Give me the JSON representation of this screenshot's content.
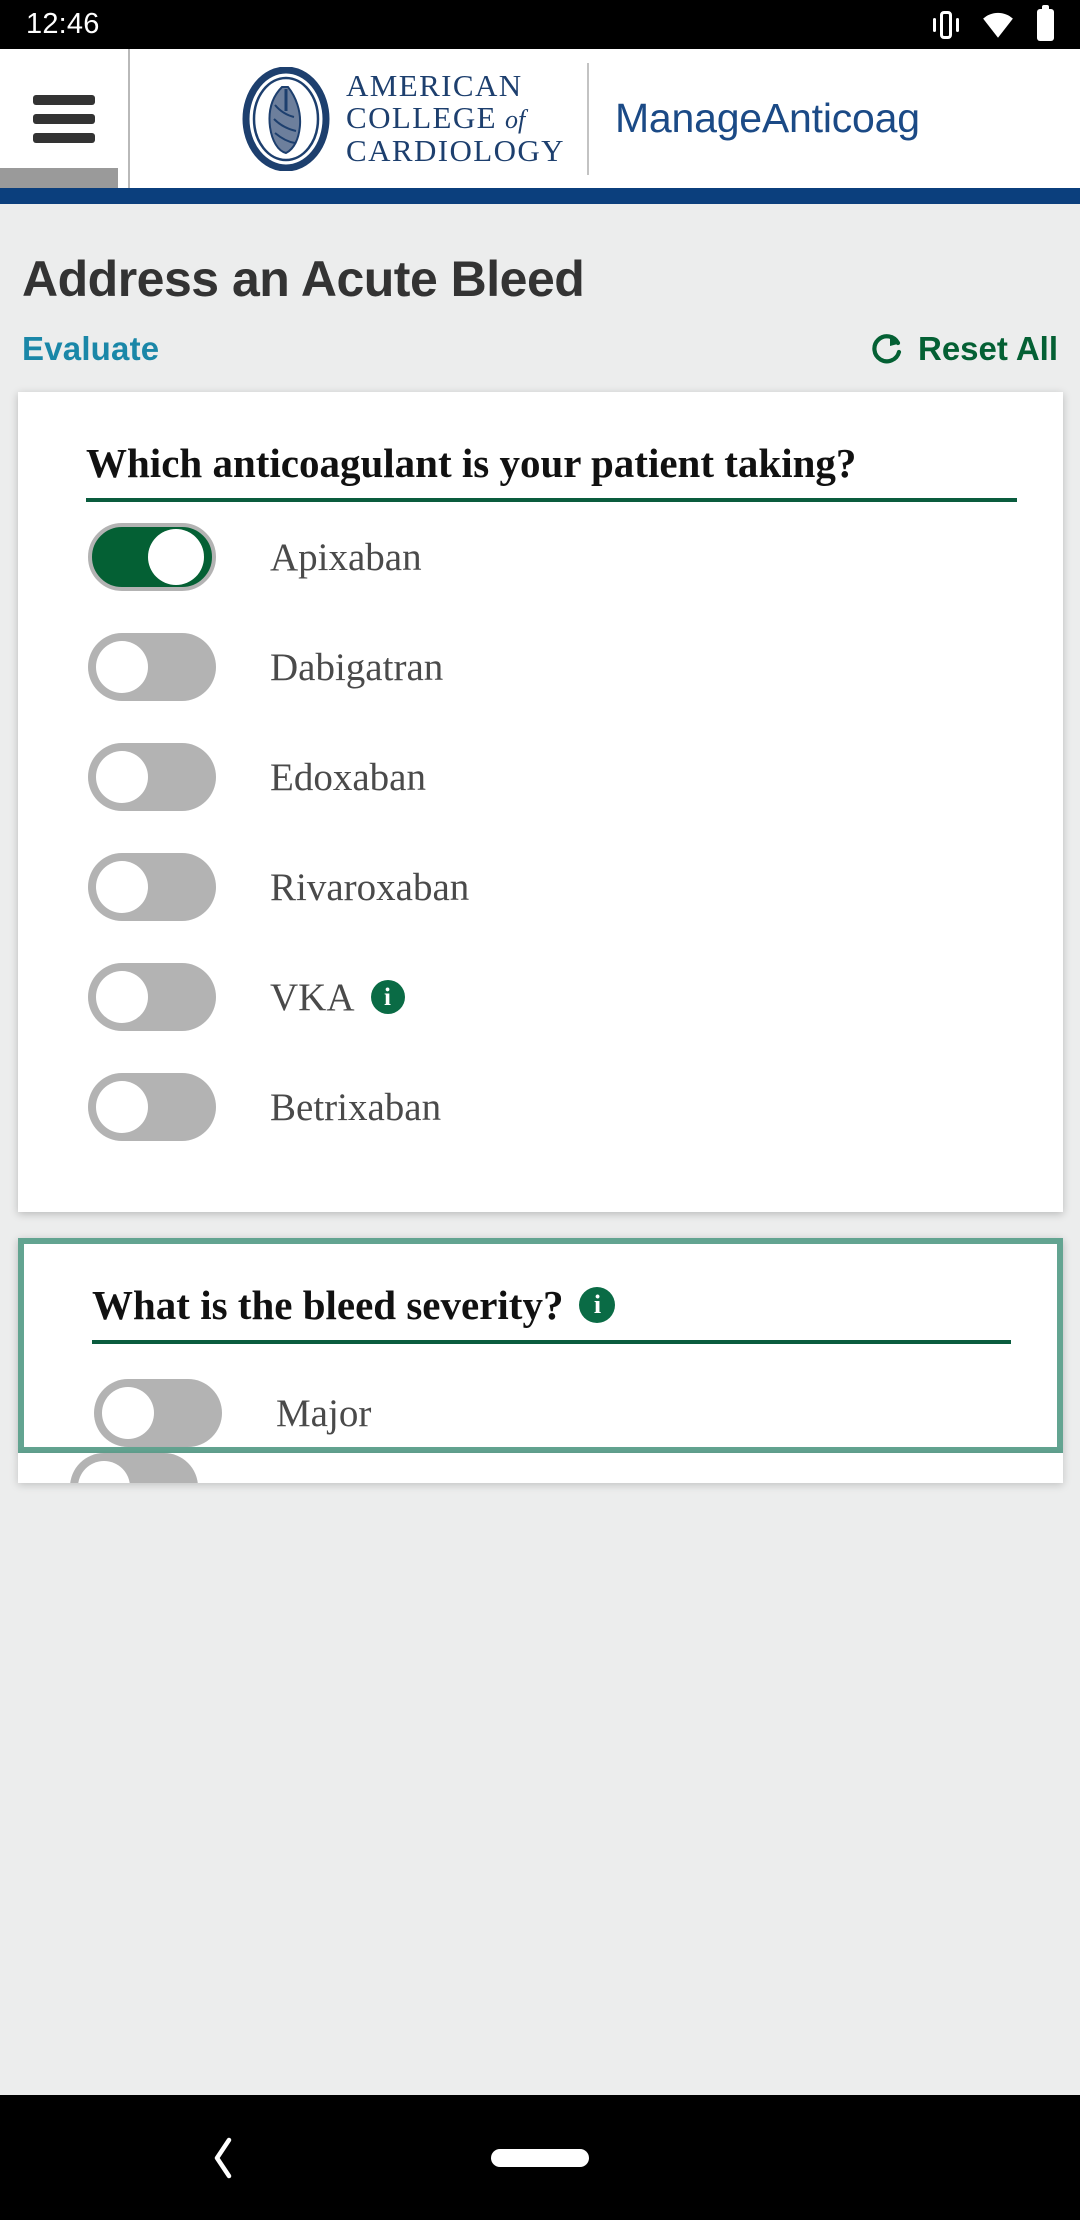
{
  "status_bar": {
    "time": "12:46",
    "icons": [
      "vibrate-icon",
      "wifi-icon",
      "battery-icon"
    ]
  },
  "header": {
    "menu_icon": "hamburger-menu-icon",
    "logo": {
      "line1": "AMERICAN",
      "line2": "COLLEGE",
      "line2_italic": "of",
      "line3": "CARDIOLOGY",
      "seal": "acc-heart-seal-icon"
    },
    "app_title": "ManageAnticoag",
    "brand_color": "#1b4a86",
    "accent_bar_color": "#0b3f7d"
  },
  "page": {
    "title": "Address an Acute Bleed",
    "evaluate_label": "Evaluate",
    "evaluate_color": "#1a87a8",
    "reset_label": "Reset All",
    "reset_color": "#046034",
    "reset_icon": "refresh-icon"
  },
  "cards": [
    {
      "question": "Which anticoagulant is your patient taking?",
      "has_info": false,
      "highlighted": false,
      "options": [
        {
          "label": "Apixaban",
          "on": true,
          "info": false
        },
        {
          "label": "Dabigatran",
          "on": false,
          "info": false
        },
        {
          "label": "Edoxaban",
          "on": false,
          "info": false
        },
        {
          "label": "Rivaroxaban",
          "on": false,
          "info": false
        },
        {
          "label": "VKA",
          "on": false,
          "info": true
        },
        {
          "label": "Betrixaban",
          "on": false,
          "info": false
        }
      ]
    },
    {
      "question": "What is the bleed severity?",
      "has_info": true,
      "highlighted": true,
      "options": [
        {
          "label": "Major",
          "on": false,
          "info": false
        }
      ]
    }
  ],
  "colors": {
    "toggle_on": "#046034",
    "toggle_off": "#b3b3b3",
    "card_highlight_border": "#63a491",
    "question_underline": "#0a5c3e",
    "info_badge": "#0a6b45",
    "page_background": "#eceded"
  },
  "nav_bar": {
    "back_icon": "back-chevron-icon",
    "home_icon": "home-pill-icon"
  },
  "info_glyph": "i"
}
